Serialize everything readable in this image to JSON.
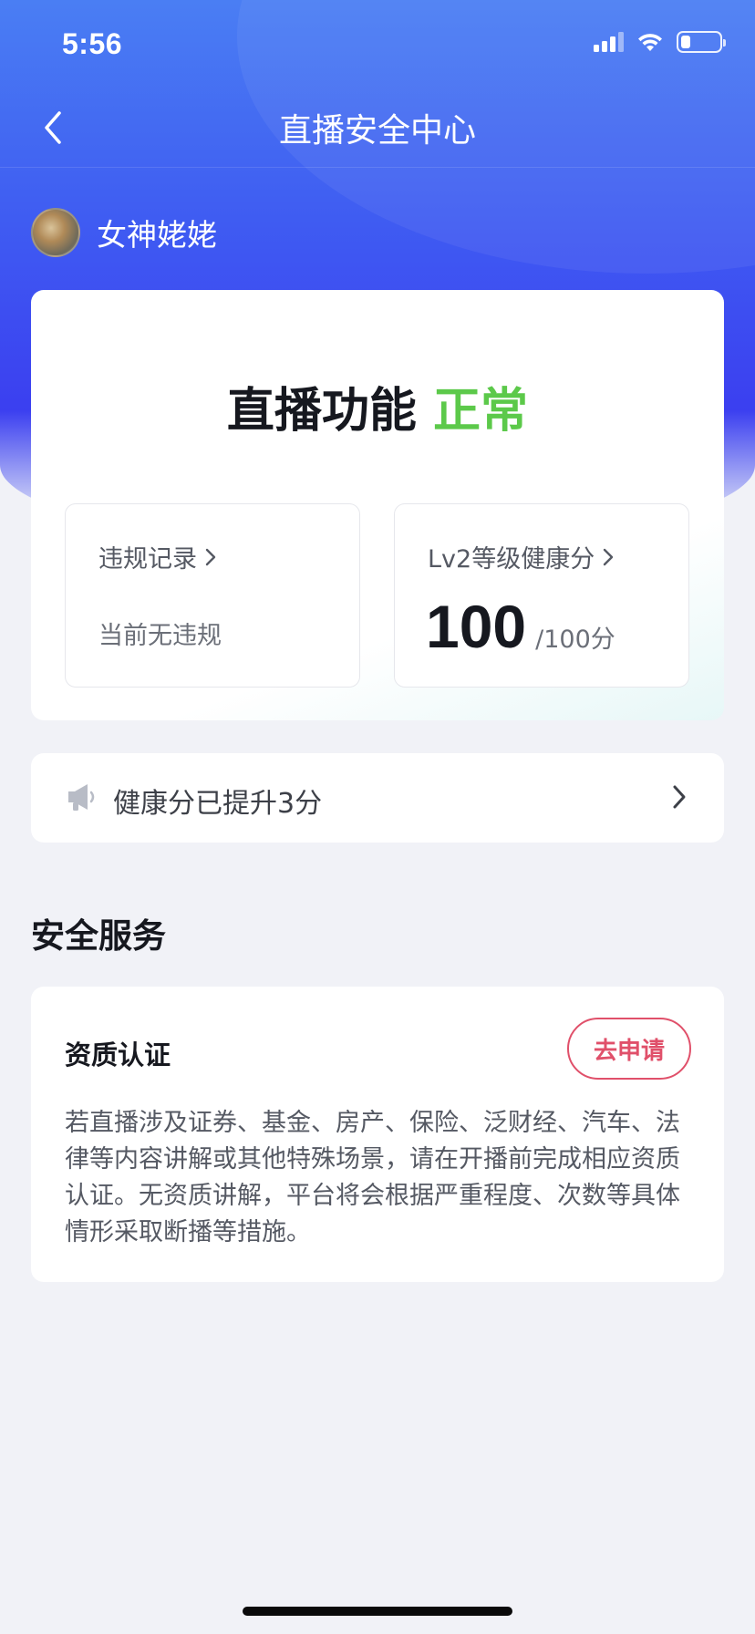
{
  "status_bar": {
    "time": "5:56",
    "signal_icon": "cellular-signal-icon",
    "wifi_icon": "wifi-icon",
    "battery_icon": "battery-icon",
    "battery_level": 0.25
  },
  "nav": {
    "back_icon": "chevron-left-icon",
    "title": "直播安全中心"
  },
  "user": {
    "name": "女神姥姥"
  },
  "live_status": {
    "label": "直播功能",
    "status": "正常",
    "status_color": "#5cc94a"
  },
  "violations": {
    "title": "违规记录",
    "value": "当前无违规"
  },
  "health_score": {
    "title": "Lv2等级健康分",
    "score": "100",
    "total": "/100分"
  },
  "notice": {
    "icon": "megaphone-icon",
    "text": "健康分已提升3分"
  },
  "safety_services": {
    "section_title": "安全服务",
    "qualification": {
      "title": "资质认证",
      "button_label": "去申请",
      "button_color": "#e0506a",
      "description": "若直播涉及证券、基金、房产、保险、泛财经、汽车、法律等内容讲解或其他特殊场景，请在开播前完成相应资质认证。无资质讲解，平台将会根据严重程度、次数等具体情形采取断播等措施。"
    }
  },
  "colors": {
    "header_gradient_top": "#4a7ef3",
    "header_gradient_bottom": "#3b3ff0",
    "page_background": "#f1f2f7"
  }
}
